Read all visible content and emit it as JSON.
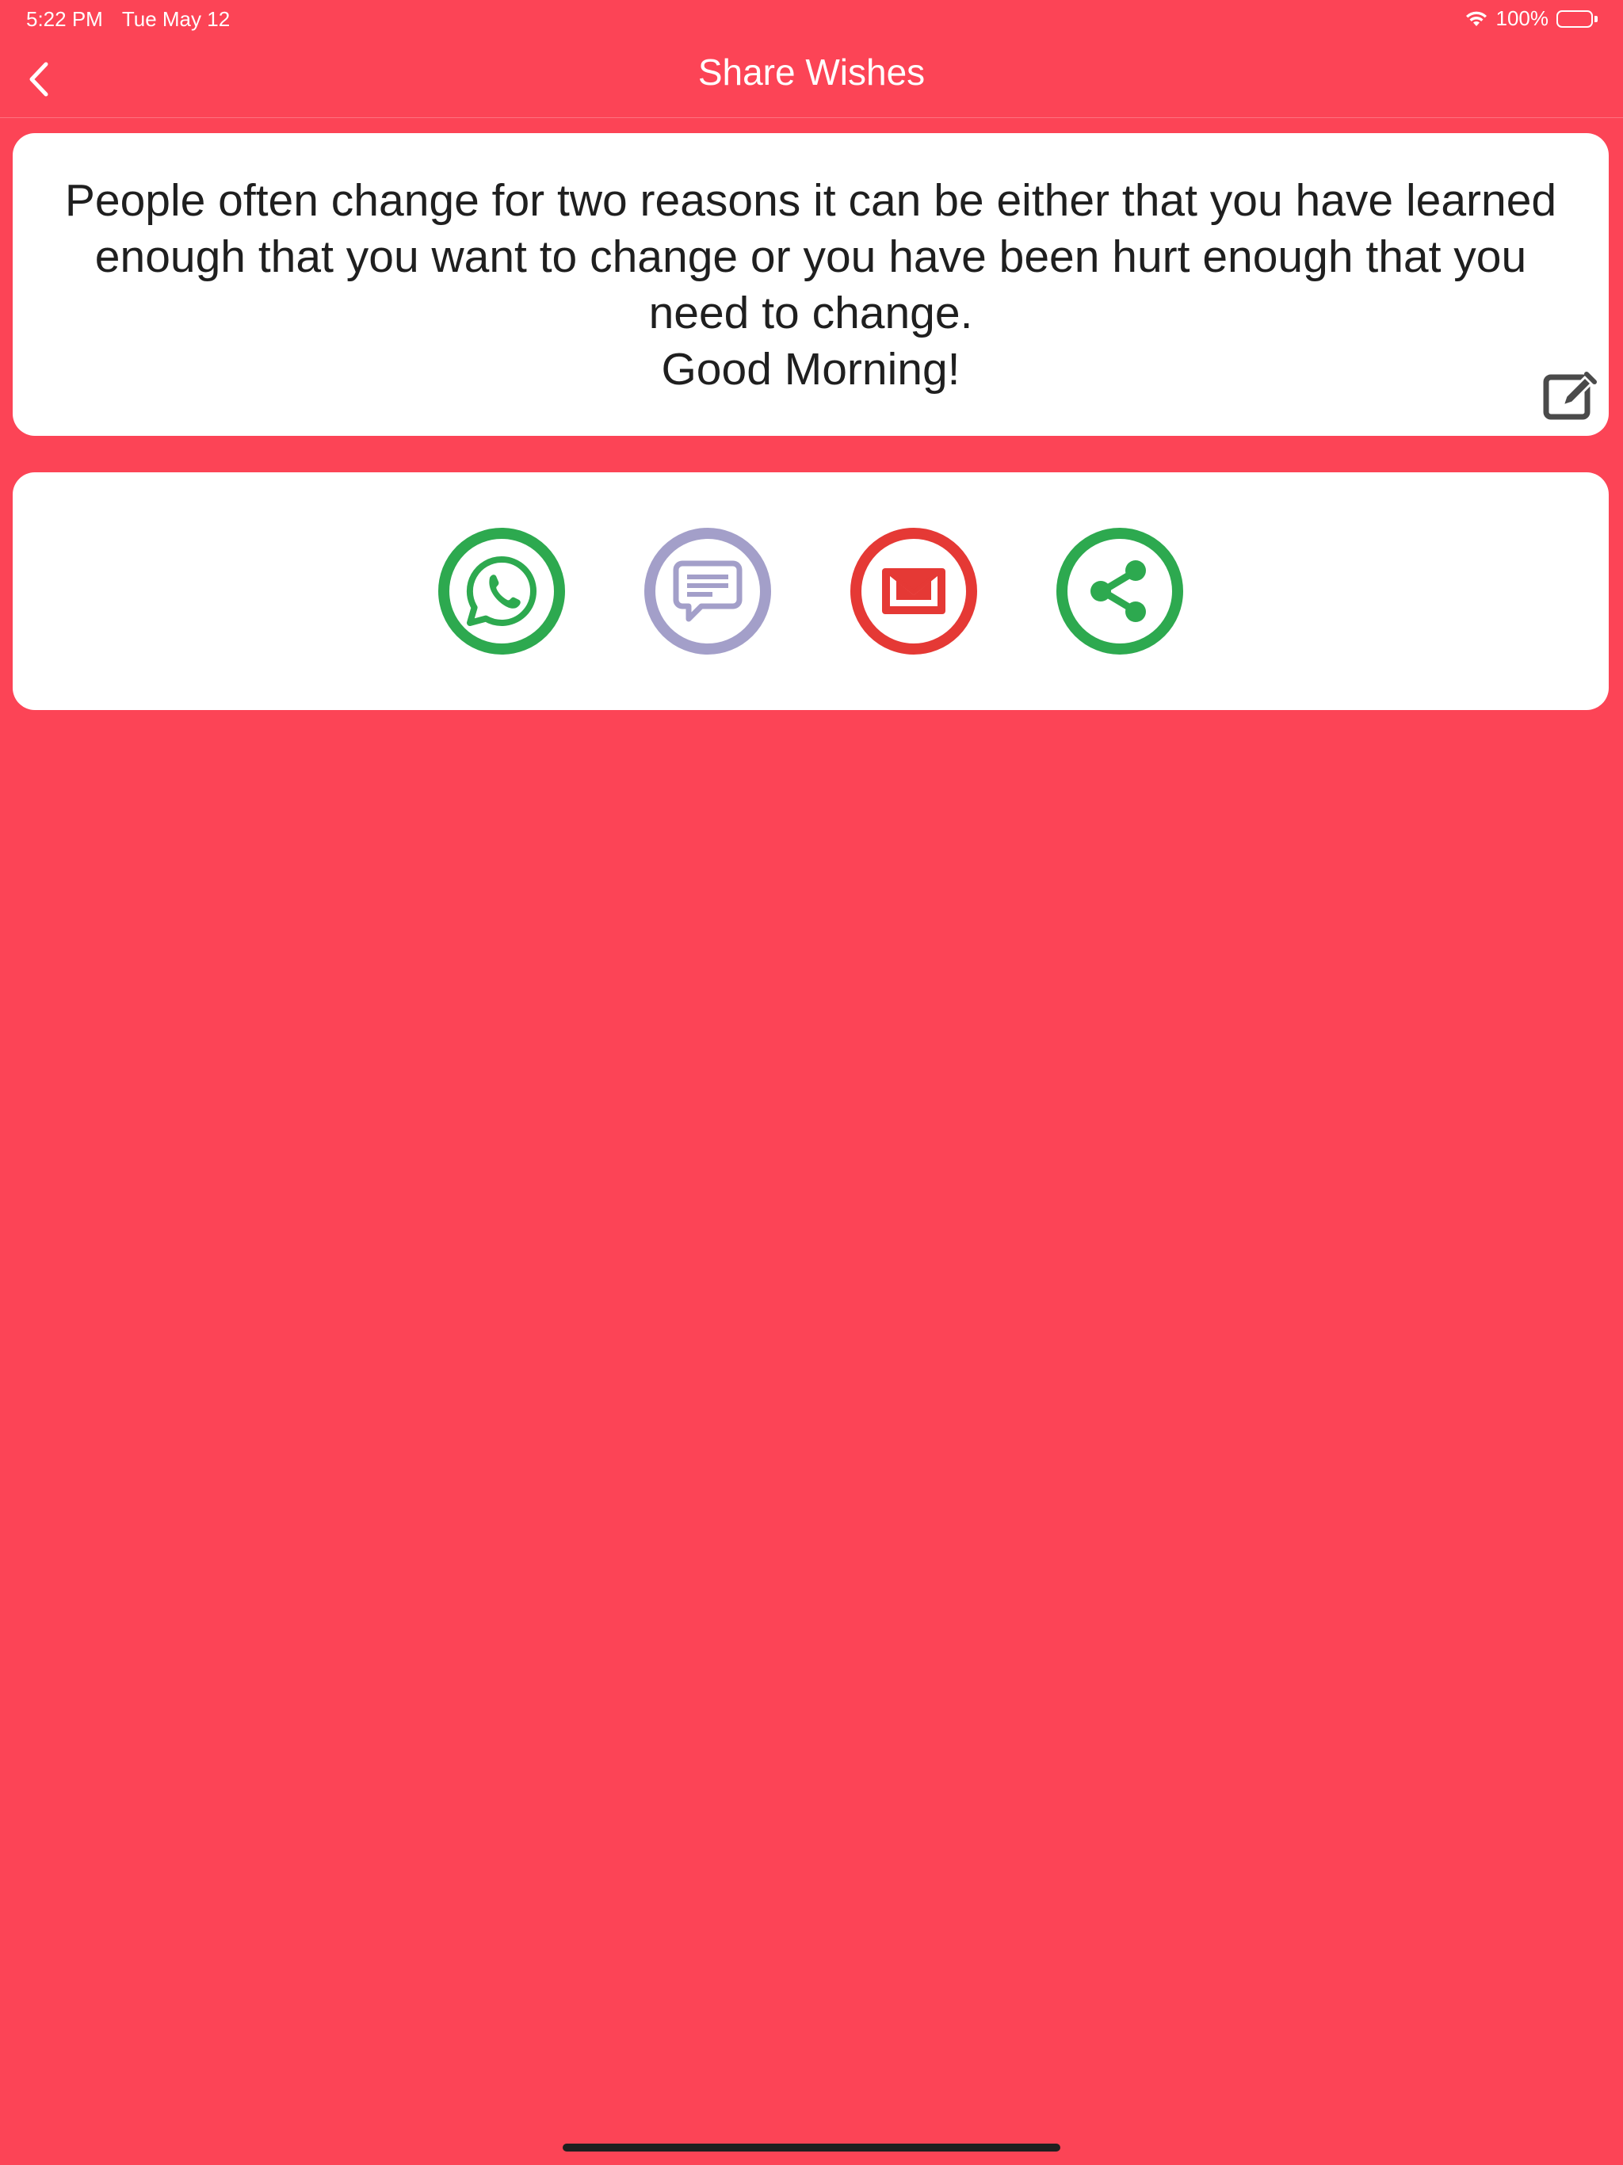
{
  "status_bar": {
    "time": "5:22 PM",
    "date": "Tue May 12",
    "battery": "100%",
    "wifi_icon": "wifi-icon",
    "battery_icon": "battery-icon"
  },
  "nav": {
    "title": "Share Wishes",
    "back_icon": "chevron-left-icon"
  },
  "message": {
    "text": "People often change for two reasons it can be either that you have learned enough that you want to change or you have been hurt enough that you need to change.\nGood Morning!",
    "edit_icon": "edit-icon"
  },
  "share_options": [
    {
      "name": "whatsapp",
      "icon": "whatsapp-icon",
      "color": "#2da94f"
    },
    {
      "name": "message",
      "icon": "message-icon",
      "color": "#a39fc9"
    },
    {
      "name": "email",
      "icon": "email-icon",
      "color": "#e53935"
    },
    {
      "name": "share",
      "icon": "share-icon",
      "color": "#2da94f"
    }
  ],
  "colors": {
    "background": "#fc4456",
    "card": "#ffffff",
    "text": "#1f1f1f"
  }
}
